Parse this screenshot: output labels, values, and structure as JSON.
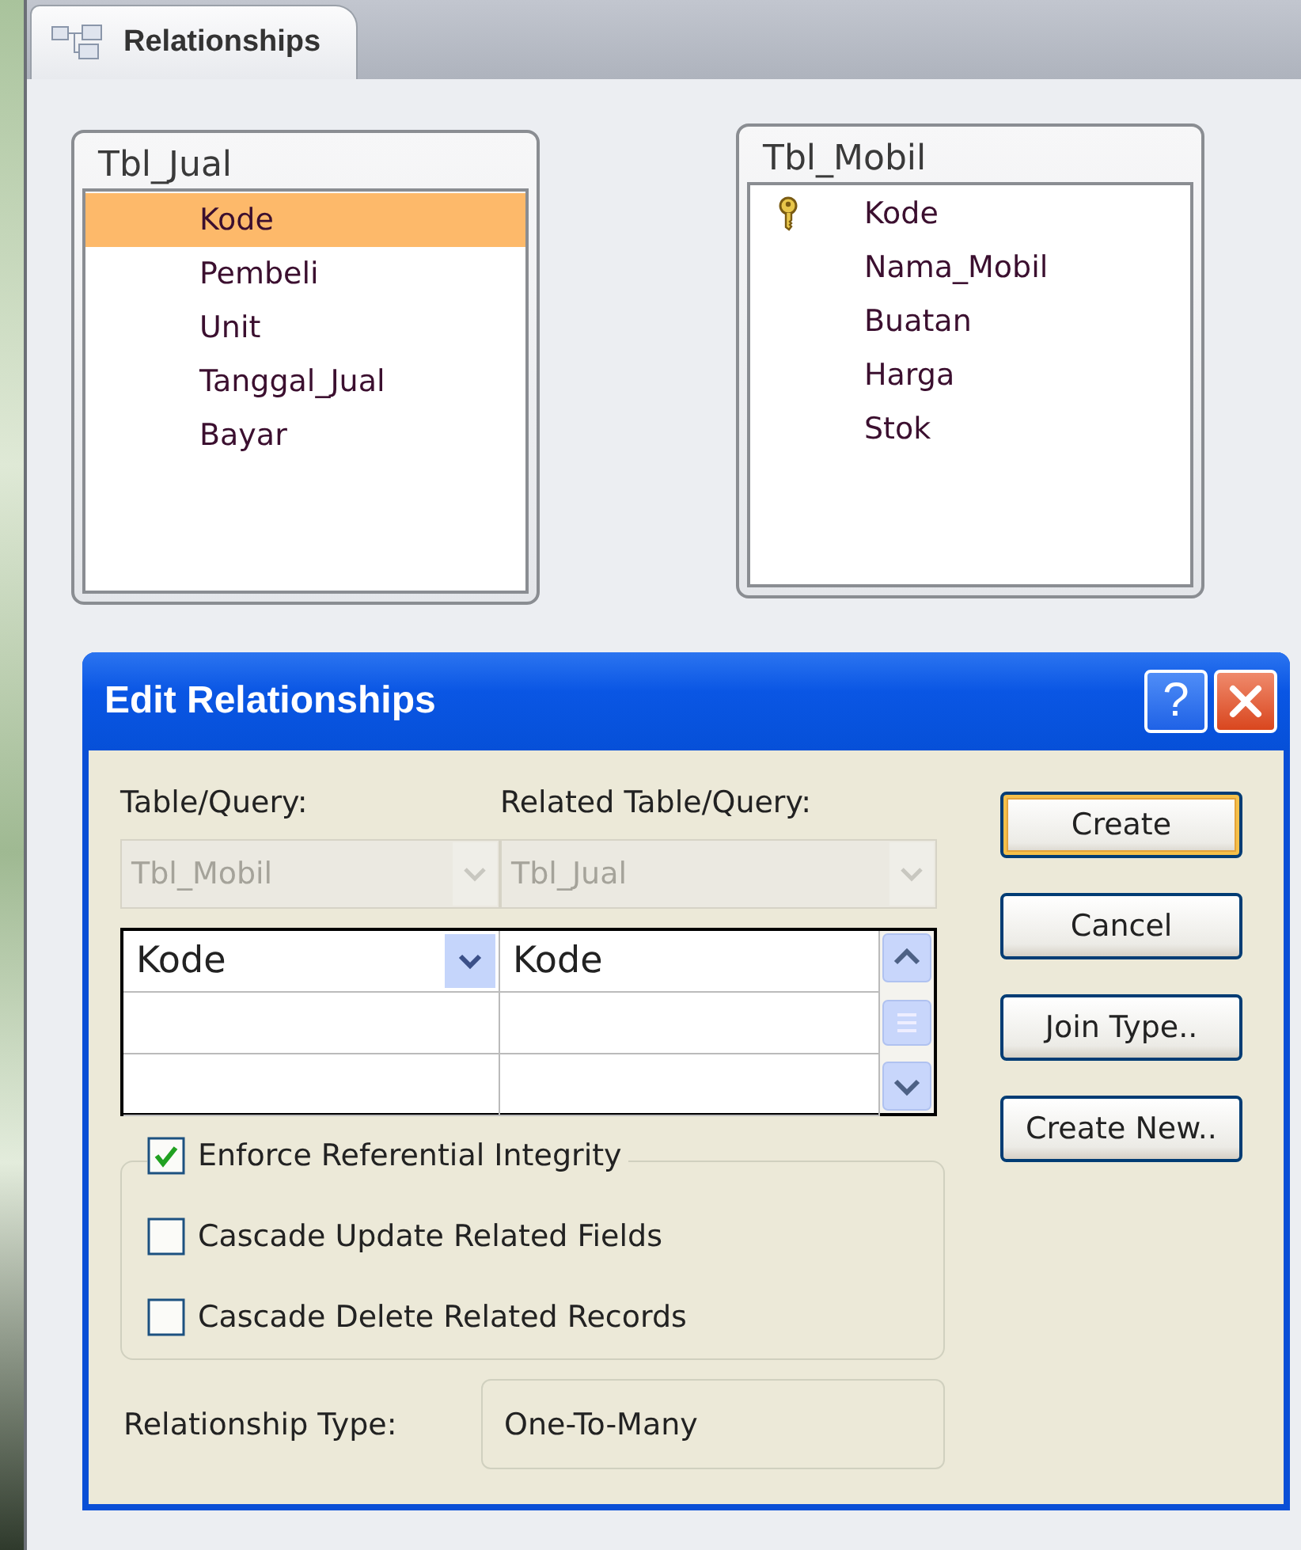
{
  "tab": {
    "label": "Relationships",
    "selected": true
  },
  "tables": [
    {
      "name": "Tbl_Jual",
      "fields": [
        {
          "name": "Kode",
          "selected": true,
          "primary_key": false
        },
        {
          "name": "Pembeli",
          "selected": false,
          "primary_key": false
        },
        {
          "name": "Unit",
          "selected": false,
          "primary_key": false
        },
        {
          "name": "Tanggal_Jual",
          "selected": false,
          "primary_key": false
        },
        {
          "name": "Bayar",
          "selected": false,
          "primary_key": false
        }
      ]
    },
    {
      "name": "Tbl_Mobil",
      "fields": [
        {
          "name": "Kode",
          "selected": false,
          "primary_key": true
        },
        {
          "name": "Nama_Mobil",
          "selected": false,
          "primary_key": false
        },
        {
          "name": "Buatan",
          "selected": false,
          "primary_key": false
        },
        {
          "name": "Harga",
          "selected": false,
          "primary_key": false
        },
        {
          "name": "Stok",
          "selected": false,
          "primary_key": false
        }
      ]
    }
  ],
  "dialog": {
    "title": "Edit Relationships",
    "help_button": "?",
    "table_label": "Table/Query:",
    "related_label": "Related Table/Query:",
    "table_value": "Tbl_Mobil",
    "related_value": "Tbl_Jual",
    "combos_disabled": true,
    "field_rows": [
      {
        "field": "Kode",
        "related_field": "Kode"
      }
    ],
    "options": [
      {
        "label": "Enforce Referential Integrity",
        "checked": true
      },
      {
        "label": "Cascade Update Related Fields",
        "checked": false
      },
      {
        "label": "Cascade Delete Related Records",
        "checked": false
      }
    ],
    "relationship_type_label": "Relationship Type:",
    "relationship_type": "One-To-Many",
    "buttons": [
      {
        "label": "Create",
        "default": true
      },
      {
        "label": "Cancel",
        "default": false
      },
      {
        "label": "Join Type..",
        "default": false
      },
      {
        "label": "Create New..",
        "default": false
      }
    ]
  }
}
